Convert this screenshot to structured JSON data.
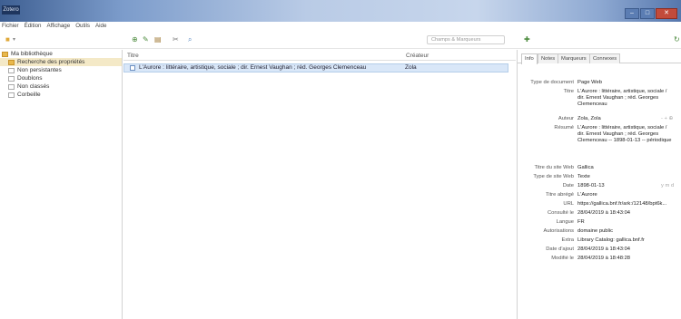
{
  "window": {
    "title": "Zotero",
    "controls": [
      "–",
      "□",
      "✕"
    ]
  },
  "menu": [
    "Fichier",
    "Édition",
    "Affichage",
    "Outils",
    "Aide"
  ],
  "toolbar": {
    "icons": [
      "new-collection-icon",
      "new-item-icon",
      "add-by-identifier-icon",
      "new-note-icon",
      "attach-icon",
      "locate-icon",
      "sync-icon"
    ],
    "search_placeholder": "Champs & Marqueurs"
  },
  "library": {
    "items": [
      {
        "label": "Ma bibliothèque",
        "icon": "library-icon",
        "selected": false
      },
      {
        "label": "Recherche des propriétés",
        "icon": "folder-icon",
        "selected": true
      },
      {
        "label": "Non persistantes",
        "icon": "doc-icon",
        "selected": false
      },
      {
        "label": "Doublons",
        "icon": "doc-icon",
        "selected": false
      },
      {
        "label": "Non classés",
        "icon": "doc-icon",
        "selected": false
      },
      {
        "label": "Corbeille",
        "icon": "trash-icon",
        "selected": false
      }
    ]
  },
  "items_table": {
    "columns": [
      "Titre",
      "Créateur"
    ],
    "rows": [
      {
        "title": "L'Aurore : littéraire, artistique, sociale ; dir. Ernest Vaughan ; réd. Georges Clemenceau",
        "creator": "Zola"
      }
    ]
  },
  "item_pane": {
    "tabs": [
      "Info",
      "Notes",
      "Marqueurs",
      "Connexes"
    ],
    "active_tab": "Info",
    "fields": [
      {
        "label": "Type de document",
        "value": "Page Web"
      },
      {
        "label": "Titre",
        "value": "L'Aurore : littéraire, artistique, sociale / dir. Ernest Vaughan ; réd. Georges Clemenceau"
      },
      {
        "label": "Auteur",
        "value": "Zola, Zola"
      },
      {
        "label": "Résumé",
        "value": "L'Aurore : littéraire, artistique, sociale / dir. Ernest Vaughan ; réd. Georges Clemenceau -- 1898-01-13 -- périodique"
      },
      {
        "label": "Titre du site Web",
        "value": "Gallica"
      },
      {
        "label": "Type de site Web",
        "value": "Texte"
      },
      {
        "label": "Date",
        "value": "1898-01-13"
      },
      {
        "label": "Titre abrégé",
        "value": "L'Aurore"
      },
      {
        "label": "URL",
        "value": "https://gallica.bnf.fr/ark:/12148/bpt6k..."
      },
      {
        "label": "Consulté le",
        "value": "28/04/2019 à 18:43:04"
      },
      {
        "label": "Langue",
        "value": "FR"
      },
      {
        "label": "Autorisations",
        "value": "domaine public"
      },
      {
        "label": "Extra",
        "value": "Library Catalog: gallica.bnf.fr"
      },
      {
        "label": "Date d'ajout",
        "value": "28/04/2019 à 18:43:04"
      },
      {
        "label": "Modifié le",
        "value": "28/04/2019 à 18:48:28"
      }
    ],
    "date_extra": "y m d",
    "author_extra": "- + ⊕"
  }
}
